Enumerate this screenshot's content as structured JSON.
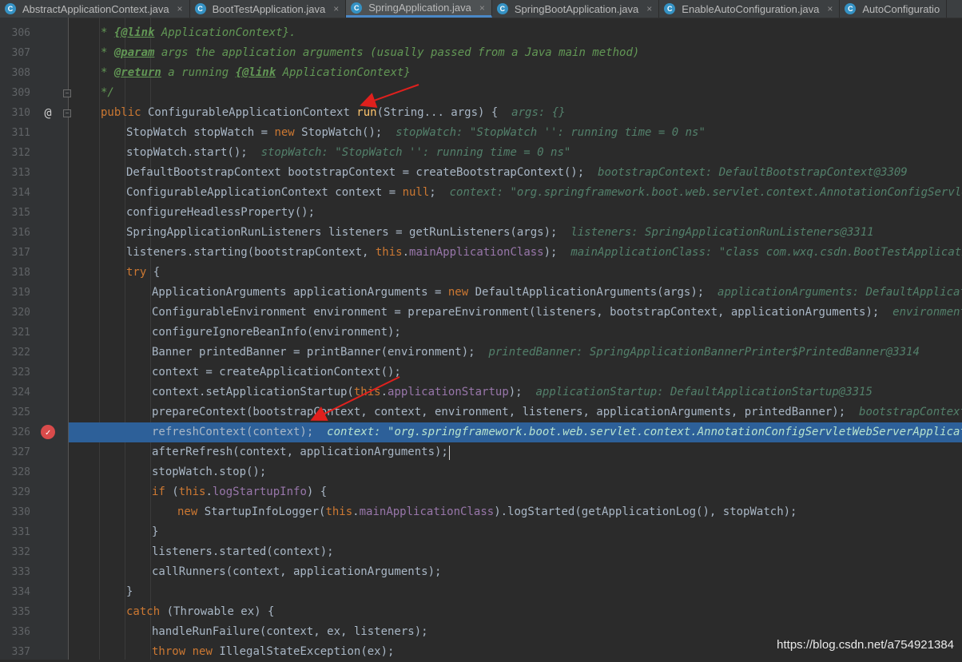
{
  "tabs": [
    {
      "label": "AbstractApplicationContext.java",
      "active": false
    },
    {
      "label": "BootTestApplication.java",
      "active": false
    },
    {
      "label": "SpringApplication.java",
      "active": true
    },
    {
      "label": "SpringBootApplication.java",
      "active": false
    },
    {
      "label": "EnableAutoConfiguration.java",
      "active": false
    },
    {
      "label": "AutoConfiguratio",
      "active": false
    }
  ],
  "editor": {
    "breakpoint_line": 326,
    "override_line": 310,
    "lines": [
      {
        "n": 306,
        "indent": 1,
        "tokens": [
          [
            "c",
            "* "
          ],
          [
            "ct",
            "{@link"
          ],
          [
            "c",
            " ApplicationContext}."
          ]
        ]
      },
      {
        "n": 307,
        "indent": 1,
        "tokens": [
          [
            "c",
            "* "
          ],
          [
            "ct",
            "@param"
          ],
          [
            "c",
            " args the application arguments (usually passed from a Java main method)"
          ]
        ]
      },
      {
        "n": 308,
        "indent": 1,
        "tokens": [
          [
            "c",
            "* "
          ],
          [
            "ct",
            "@return"
          ],
          [
            "c",
            " a running "
          ],
          [
            "ct",
            "{@link"
          ],
          [
            "c",
            " ApplicationContext}"
          ]
        ]
      },
      {
        "n": 309,
        "indent": 1,
        "tokens": [
          [
            "c",
            "*/"
          ]
        ]
      },
      {
        "n": 310,
        "indent": 1,
        "tokens": [
          [
            "k",
            "public"
          ],
          [
            "p",
            " ConfigurableApplicationContext "
          ],
          [
            "m",
            "run"
          ],
          [
            "p",
            "(String... args) {  "
          ],
          [
            "h",
            "args: {}"
          ]
        ]
      },
      {
        "n": 311,
        "indent": 2,
        "tokens": [
          [
            "p",
            "StopWatch stopWatch = "
          ],
          [
            "k",
            "new"
          ],
          [
            "p",
            " StopWatch();  "
          ],
          [
            "h",
            "stopWatch: \"StopWatch '': running time = 0 ns\""
          ]
        ]
      },
      {
        "n": 312,
        "indent": 2,
        "tokens": [
          [
            "p",
            "stopWatch.start();  "
          ],
          [
            "h",
            "stopWatch: \"StopWatch '': running time = 0 ns\""
          ]
        ]
      },
      {
        "n": 313,
        "indent": 2,
        "tokens": [
          [
            "p",
            "DefaultBootstrapContext bootstrapContext = createBootstrapContext();  "
          ],
          [
            "h",
            "bootstrapContext: DefaultBootstrapContext@3309"
          ]
        ]
      },
      {
        "n": 314,
        "indent": 2,
        "tokens": [
          [
            "p",
            "ConfigurableApplicationContext context = "
          ],
          [
            "k",
            "null"
          ],
          [
            "p",
            ";  "
          ],
          [
            "h",
            "context: \"org.springframework.boot.web.servlet.context.AnnotationConfigServletWebSe"
          ]
        ]
      },
      {
        "n": 315,
        "indent": 2,
        "tokens": [
          [
            "p",
            "configureHeadlessProperty();"
          ]
        ]
      },
      {
        "n": 316,
        "indent": 2,
        "tokens": [
          [
            "p",
            "SpringApplicationRunListeners listeners = getRunListeners(args);  "
          ],
          [
            "h",
            "listeners: SpringApplicationRunListeners@3311"
          ]
        ]
      },
      {
        "n": 317,
        "indent": 2,
        "tokens": [
          [
            "p",
            "listeners.starting(bootstrapContext, "
          ],
          [
            "k",
            "this"
          ],
          [
            "p",
            "."
          ],
          [
            "f",
            "mainApplicationClass"
          ],
          [
            "p",
            ");  "
          ],
          [
            "h",
            "mainApplicationClass: \"class com.wxq.csdn.BootTestApplication\""
          ]
        ]
      },
      {
        "n": 318,
        "indent": 2,
        "tokens": [
          [
            "k",
            "try"
          ],
          [
            "p",
            " {"
          ]
        ]
      },
      {
        "n": 319,
        "indent": 3,
        "tokens": [
          [
            "p",
            "ApplicationArguments applicationArguments = "
          ],
          [
            "k",
            "new"
          ],
          [
            "p",
            " DefaultApplicationArguments(args);  "
          ],
          [
            "h",
            "applicationArguments: DefaultApplicationArg"
          ]
        ]
      },
      {
        "n": 320,
        "indent": 3,
        "tokens": [
          [
            "p",
            "ConfigurableEnvironment environment = prepareEnvironment(listeners, bootstrapContext, applicationArguments);  "
          ],
          [
            "h",
            "environment: \"Sta"
          ]
        ]
      },
      {
        "n": 321,
        "indent": 3,
        "tokens": [
          [
            "p",
            "configureIgnoreBeanInfo(environment);"
          ]
        ]
      },
      {
        "n": 322,
        "indent": 3,
        "tokens": [
          [
            "p",
            "Banner printedBanner = printBanner(environment);  "
          ],
          [
            "h",
            "printedBanner: SpringApplicationBannerPrinter$PrintedBanner@3314"
          ]
        ]
      },
      {
        "n": 323,
        "indent": 3,
        "tokens": [
          [
            "p",
            "context = createApplicationContext();"
          ]
        ]
      },
      {
        "n": 324,
        "indent": 3,
        "tokens": [
          [
            "p",
            "context.setApplicationStartup("
          ],
          [
            "k",
            "this"
          ],
          [
            "p",
            "."
          ],
          [
            "f",
            "applicationStartup"
          ],
          [
            "p",
            ");  "
          ],
          [
            "h",
            "applicationStartup: DefaultApplicationStartup@3315"
          ]
        ]
      },
      {
        "n": 325,
        "indent": 3,
        "tokens": [
          [
            "p",
            "prepareContext(bootstrapContext, context, environment, listeners, applicationArguments, printedBanner);  "
          ],
          [
            "h",
            "bootstrapContext: Defa"
          ]
        ]
      },
      {
        "n": 326,
        "indent": 3,
        "tokens": [
          [
            "p",
            "refreshContext(context);  "
          ],
          [
            "h",
            "context: \"org.springframework.boot.web.servlet.context.AnnotationConfigServletWebServerApplicationCon"
          ]
        ]
      },
      {
        "n": 327,
        "indent": 3,
        "tokens": [
          [
            "p",
            "afterRefresh(context, applicationArguments);"
          ]
        ]
      },
      {
        "n": 328,
        "indent": 3,
        "tokens": [
          [
            "p",
            "stopWatch.stop();"
          ]
        ]
      },
      {
        "n": 329,
        "indent": 3,
        "tokens": [
          [
            "k",
            "if"
          ],
          [
            "p",
            " ("
          ],
          [
            "k",
            "this"
          ],
          [
            "p",
            "."
          ],
          [
            "f",
            "logStartupInfo"
          ],
          [
            "p",
            ") {"
          ]
        ]
      },
      {
        "n": 330,
        "indent": 4,
        "tokens": [
          [
            "k",
            "new"
          ],
          [
            "p",
            " StartupInfoLogger("
          ],
          [
            "k",
            "this"
          ],
          [
            "p",
            "."
          ],
          [
            "f",
            "mainApplicationClass"
          ],
          [
            "p",
            ").logStarted(getApplicationLog(), stopWatch);"
          ]
        ]
      },
      {
        "n": 331,
        "indent": 3,
        "tokens": [
          [
            "p",
            "}"
          ]
        ]
      },
      {
        "n": 332,
        "indent": 3,
        "tokens": [
          [
            "p",
            "listeners.started(context);"
          ]
        ]
      },
      {
        "n": 333,
        "indent": 3,
        "tokens": [
          [
            "p",
            "callRunners(context, applicationArguments);"
          ]
        ]
      },
      {
        "n": 334,
        "indent": 2,
        "tokens": [
          [
            "p",
            "}"
          ]
        ]
      },
      {
        "n": 335,
        "indent": 2,
        "tokens": [
          [
            "k",
            "catch"
          ],
          [
            "p",
            " (Throwable ex) {"
          ]
        ]
      },
      {
        "n": 336,
        "indent": 3,
        "tokens": [
          [
            "p",
            "handleRunFailure(context, ex, listeners);"
          ]
        ]
      },
      {
        "n": 337,
        "indent": 3,
        "tokens": [
          [
            "k",
            "throw"
          ],
          [
            "p",
            " "
          ],
          [
            "k",
            "new"
          ],
          [
            "p",
            " IllegalStateException(ex);"
          ]
        ]
      }
    ]
  },
  "watermark": "https://blog.csdn.net/a754921384",
  "colors": {
    "background": "#2b2b2b",
    "highlight": "#2d6099",
    "keyword": "#cc7832",
    "comment": "#629755",
    "field": "#9876aa",
    "method": "#ffc66d",
    "hint": "#53806b",
    "annotation_arrow": "#e0201d"
  }
}
